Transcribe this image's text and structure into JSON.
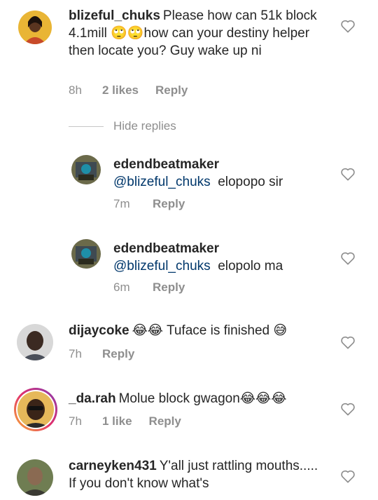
{
  "comments": [
    {
      "username": "blizeful_chuks",
      "text": "Please how can 51k block 4.1mill 🙄🙄how can your destiny helper then locate you?  Guy wake up ni",
      "time": "8h",
      "likes": "2 likes",
      "reply": "Reply"
    },
    {
      "username": "edendbeatmaker",
      "mention": "@blizeful_chuks",
      "text": "elopopo sir",
      "time": "7m",
      "reply": "Reply"
    },
    {
      "username": "edendbeatmaker",
      "mention": "@blizeful_chuks",
      "text": "elopolo ma",
      "time": "6m",
      "reply": "Reply"
    },
    {
      "username": "dijaycoke",
      "text": "😂😂 Tuface is finished 😅",
      "time": "7h",
      "reply": "Reply"
    },
    {
      "username": "_da.rah",
      "text": "Molue block gwagon😂😂😂",
      "time": "7h",
      "likes": "1 like",
      "reply": "Reply"
    },
    {
      "username": "carneyken431",
      "text": "Y'all just rattling mouths..... If you don't know what's"
    }
  ],
  "hide_replies": "Hide replies",
  "colors": {
    "text": "#262626",
    "meta": "#8e8e8e",
    "mention": "#00376b",
    "story_ring": "#d6249f"
  },
  "icons": {
    "like": "heart-outline-icon"
  }
}
